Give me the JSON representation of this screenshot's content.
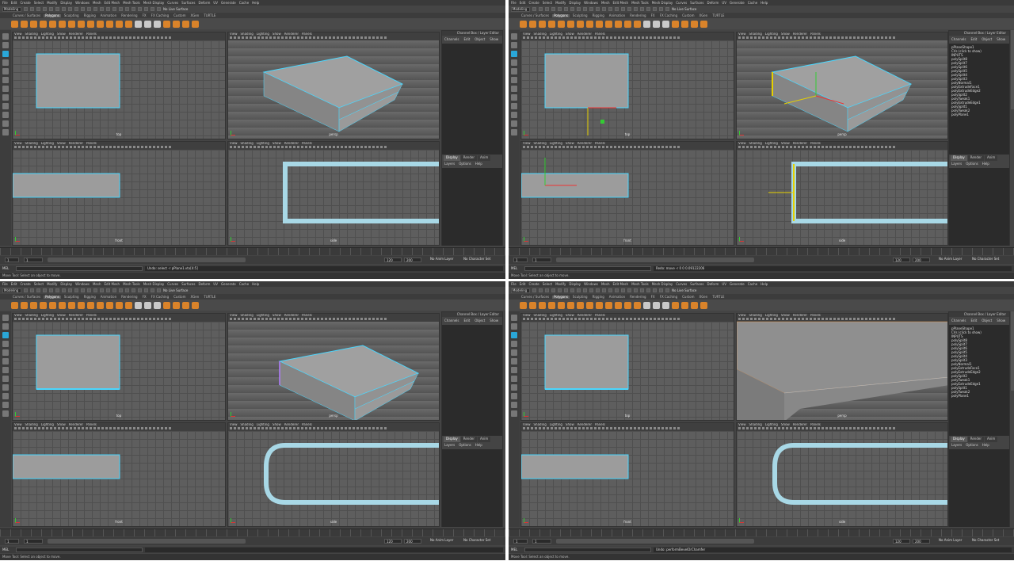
{
  "menu": [
    "File",
    "Edit",
    "Create",
    "Select",
    "Modify",
    "Display",
    "Windows",
    "Mesh",
    "Edit Mesh",
    "Mesh Tools",
    "Mesh Display",
    "Curves",
    "Surfaces",
    "Deform",
    "UV",
    "Generate",
    "Cache",
    "Help"
  ],
  "mode_dropdown": "Modeling",
  "no_live_surface": "No Live Surface",
  "shelf_tabs": [
    "Curves / Surfaces",
    "Polygons",
    "Sculpting",
    "Rigging",
    "Animation",
    "Rendering",
    "FX",
    "FX Caching",
    "Custom",
    "XGen",
    "TURTLE"
  ],
  "active_shelf": "Polygons",
  "viewport_menu": [
    "View",
    "Shading",
    "Lighting",
    "Show",
    "Renderer",
    "Panels"
  ],
  "viewport_values": {
    "a": "0.00",
    "b": "1.00"
  },
  "viewport_labels": {
    "top": "top",
    "persp": "persp",
    "front": "front",
    "side": "side"
  },
  "channel_box": {
    "title": "Channel Box / Layer Editor",
    "menu": [
      "Channels",
      "Edit",
      "Object",
      "Show"
    ],
    "layer_tabs": [
      "Display",
      "Render",
      "Anim"
    ],
    "layer_menu": [
      "Layers",
      "Options",
      "Help"
    ]
  },
  "inputs_list": [
    "pPlaneShape1",
    "CVs (click to show)",
    "INPUTS",
    "polySplit8",
    "polySplit7",
    "polySplit6",
    "polySplit5",
    "polySplit4",
    "polySplit3",
    "polyNormal1",
    "polyExtrudeFace1",
    "polyExtrudeEdge2",
    "polySplit2",
    "polyTweak1",
    "polyExtrudeEdge1",
    "polySplit1",
    "polyTweak2",
    "polyPlane1"
  ],
  "range": {
    "start": "1",
    "current": "1",
    "anim_start": "1",
    "range_label": "120",
    "end": "120",
    "anim_end": "200"
  },
  "anim_layer": "No Anim Layer",
  "char_set": "No Character Set",
  "mel_label": "MEL",
  "results": [
    "Undo: select -r pPlane1.vtx[4:5]",
    "Redo: move -r 0 0 0.09122206",
    "",
    "Undo: performBevelOrChamfer"
  ],
  "help_line": "Move Tool: Select an object to move.",
  "colors": {
    "accent": "#2aa7d8",
    "orange": "#d9832a",
    "model": "#9a9a9a",
    "edge": "#4ad7ff"
  }
}
